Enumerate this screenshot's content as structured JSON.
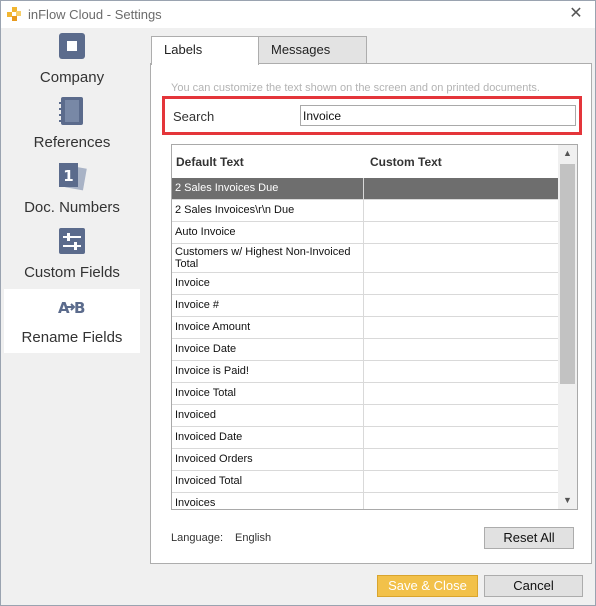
{
  "window": {
    "title": "inFlow Cloud - Settings",
    "close_glyph": "✕",
    "accent_color": "#f2c14a"
  },
  "sidebar": {
    "items": [
      {
        "label": "Company",
        "icon": "building-icon"
      },
      {
        "label": "References",
        "icon": "notebook-icon"
      },
      {
        "label": "Doc. Numbers",
        "icon": "numbered-pages-icon"
      },
      {
        "label": "Custom Fields",
        "icon": "sliders-icon"
      },
      {
        "label": "Rename Fields",
        "icon": "rename-ab-icon",
        "active": true
      }
    ]
  },
  "tabs": [
    {
      "label": "Labels",
      "active": true
    },
    {
      "label": "Messages",
      "active": false
    }
  ],
  "labels_panel": {
    "hint": "You can customize the text shown on the screen and on printed documents.",
    "search": {
      "label": "Search",
      "value": "Invoice",
      "highlight_color": "#e4353a"
    },
    "grid": {
      "columns": [
        "Default Text",
        "Custom Text"
      ],
      "rows": [
        {
          "default": "2 Sales Invoices Due",
          "custom": "",
          "selected": true
        },
        {
          "default": "2 Sales Invoices\\r\\n Due",
          "custom": ""
        },
        {
          "default": "Auto Invoice",
          "custom": ""
        },
        {
          "default": "Customers w/ Highest Non-Invoiced Total",
          "custom": ""
        },
        {
          "default": "Invoice",
          "custom": ""
        },
        {
          "default": "Invoice #",
          "custom": ""
        },
        {
          "default": "Invoice Amount",
          "custom": ""
        },
        {
          "default": "Invoice Date",
          "custom": ""
        },
        {
          "default": "Invoice is Paid!",
          "custom": ""
        },
        {
          "default": "Invoice Total",
          "custom": ""
        },
        {
          "default": "Invoiced",
          "custom": ""
        },
        {
          "default": "Invoiced Date",
          "custom": ""
        },
        {
          "default": "Invoiced Orders",
          "custom": ""
        },
        {
          "default": "Invoiced Total",
          "custom": ""
        },
        {
          "default": "Invoices",
          "custom": ""
        }
      ]
    },
    "language": {
      "label": "Language:",
      "value": "English"
    },
    "reset_label": "Reset All"
  },
  "footer": {
    "save_label": "Save & Close",
    "cancel_label": "Cancel"
  }
}
